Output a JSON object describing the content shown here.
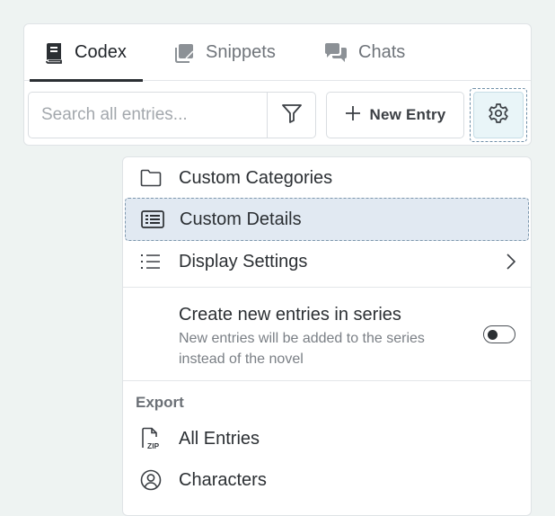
{
  "tabs": [
    {
      "label": "Codex",
      "icon": "book-icon",
      "active": true
    },
    {
      "label": "Snippets",
      "icon": "snippets-icon",
      "active": false
    },
    {
      "label": "Chats",
      "icon": "chat-icon",
      "active": false
    }
  ],
  "search": {
    "placeholder": "Search all entries...",
    "value": ""
  },
  "toolbar": {
    "new_entry_label": "New Entry"
  },
  "menu": {
    "items": [
      {
        "label": "Custom Categories",
        "icon": "folder-icon"
      },
      {
        "label": "Custom Details",
        "icon": "details-list-icon",
        "highlighted": true
      },
      {
        "label": "Display Settings",
        "icon": "list-icon",
        "submenu": true
      }
    ],
    "series": {
      "title": "Create new entries in series",
      "description": "New entries will be added to the series instead of the novel",
      "enabled": false
    },
    "export": {
      "label": "Export",
      "items": [
        {
          "label": "All Entries",
          "icon": "zip-file-icon"
        },
        {
          "label": "Characters",
          "icon": "user-circle-icon"
        }
      ]
    }
  },
  "colors": {
    "accent": "#2b2f33",
    "highlight": "#e1e9f2",
    "background": "#eef3f2"
  }
}
